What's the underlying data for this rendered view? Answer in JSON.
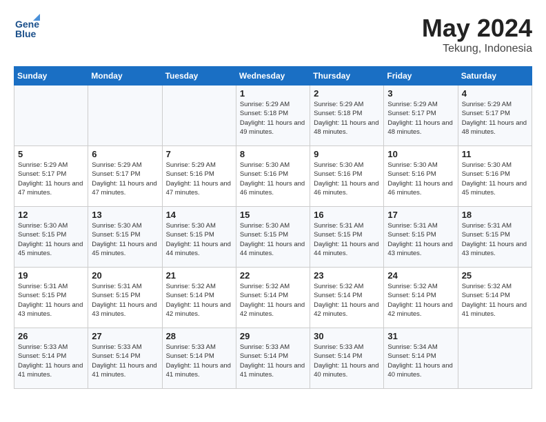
{
  "header": {
    "logo_line1": "General",
    "logo_line2": "Blue",
    "month_year": "May 2024",
    "location": "Tekung, Indonesia"
  },
  "days_of_week": [
    "Sunday",
    "Monday",
    "Tuesday",
    "Wednesday",
    "Thursday",
    "Friday",
    "Saturday"
  ],
  "weeks": [
    [
      {
        "day": "",
        "info": ""
      },
      {
        "day": "",
        "info": ""
      },
      {
        "day": "",
        "info": ""
      },
      {
        "day": "1",
        "info": "Sunrise: 5:29 AM\nSunset: 5:18 PM\nDaylight: 11 hours\nand 49 minutes."
      },
      {
        "day": "2",
        "info": "Sunrise: 5:29 AM\nSunset: 5:18 PM\nDaylight: 11 hours\nand 48 minutes."
      },
      {
        "day": "3",
        "info": "Sunrise: 5:29 AM\nSunset: 5:17 PM\nDaylight: 11 hours\nand 48 minutes."
      },
      {
        "day": "4",
        "info": "Sunrise: 5:29 AM\nSunset: 5:17 PM\nDaylight: 11 hours\nand 48 minutes."
      }
    ],
    [
      {
        "day": "5",
        "info": "Sunrise: 5:29 AM\nSunset: 5:17 PM\nDaylight: 11 hours\nand 47 minutes."
      },
      {
        "day": "6",
        "info": "Sunrise: 5:29 AM\nSunset: 5:17 PM\nDaylight: 11 hours\nand 47 minutes."
      },
      {
        "day": "7",
        "info": "Sunrise: 5:29 AM\nSunset: 5:16 PM\nDaylight: 11 hours\nand 47 minutes."
      },
      {
        "day": "8",
        "info": "Sunrise: 5:30 AM\nSunset: 5:16 PM\nDaylight: 11 hours\nand 46 minutes."
      },
      {
        "day": "9",
        "info": "Sunrise: 5:30 AM\nSunset: 5:16 PM\nDaylight: 11 hours\nand 46 minutes."
      },
      {
        "day": "10",
        "info": "Sunrise: 5:30 AM\nSunset: 5:16 PM\nDaylight: 11 hours\nand 46 minutes."
      },
      {
        "day": "11",
        "info": "Sunrise: 5:30 AM\nSunset: 5:16 PM\nDaylight: 11 hours\nand 45 minutes."
      }
    ],
    [
      {
        "day": "12",
        "info": "Sunrise: 5:30 AM\nSunset: 5:15 PM\nDaylight: 11 hours\nand 45 minutes."
      },
      {
        "day": "13",
        "info": "Sunrise: 5:30 AM\nSunset: 5:15 PM\nDaylight: 11 hours\nand 45 minutes."
      },
      {
        "day": "14",
        "info": "Sunrise: 5:30 AM\nSunset: 5:15 PM\nDaylight: 11 hours\nand 44 minutes."
      },
      {
        "day": "15",
        "info": "Sunrise: 5:30 AM\nSunset: 5:15 PM\nDaylight: 11 hours\nand 44 minutes."
      },
      {
        "day": "16",
        "info": "Sunrise: 5:31 AM\nSunset: 5:15 PM\nDaylight: 11 hours\nand 44 minutes."
      },
      {
        "day": "17",
        "info": "Sunrise: 5:31 AM\nSunset: 5:15 PM\nDaylight: 11 hours\nand 43 minutes."
      },
      {
        "day": "18",
        "info": "Sunrise: 5:31 AM\nSunset: 5:15 PM\nDaylight: 11 hours\nand 43 minutes."
      }
    ],
    [
      {
        "day": "19",
        "info": "Sunrise: 5:31 AM\nSunset: 5:15 PM\nDaylight: 11 hours\nand 43 minutes."
      },
      {
        "day": "20",
        "info": "Sunrise: 5:31 AM\nSunset: 5:15 PM\nDaylight: 11 hours\nand 43 minutes."
      },
      {
        "day": "21",
        "info": "Sunrise: 5:32 AM\nSunset: 5:14 PM\nDaylight: 11 hours\nand 42 minutes."
      },
      {
        "day": "22",
        "info": "Sunrise: 5:32 AM\nSunset: 5:14 PM\nDaylight: 11 hours\nand 42 minutes."
      },
      {
        "day": "23",
        "info": "Sunrise: 5:32 AM\nSunset: 5:14 PM\nDaylight: 11 hours\nand 42 minutes."
      },
      {
        "day": "24",
        "info": "Sunrise: 5:32 AM\nSunset: 5:14 PM\nDaylight: 11 hours\nand 42 minutes."
      },
      {
        "day": "25",
        "info": "Sunrise: 5:32 AM\nSunset: 5:14 PM\nDaylight: 11 hours\nand 41 minutes."
      }
    ],
    [
      {
        "day": "26",
        "info": "Sunrise: 5:33 AM\nSunset: 5:14 PM\nDaylight: 11 hours\nand 41 minutes."
      },
      {
        "day": "27",
        "info": "Sunrise: 5:33 AM\nSunset: 5:14 PM\nDaylight: 11 hours\nand 41 minutes."
      },
      {
        "day": "28",
        "info": "Sunrise: 5:33 AM\nSunset: 5:14 PM\nDaylight: 11 hours\nand 41 minutes."
      },
      {
        "day": "29",
        "info": "Sunrise: 5:33 AM\nSunset: 5:14 PM\nDaylight: 11 hours\nand 41 minutes."
      },
      {
        "day": "30",
        "info": "Sunrise: 5:33 AM\nSunset: 5:14 PM\nDaylight: 11 hours\nand 40 minutes."
      },
      {
        "day": "31",
        "info": "Sunrise: 5:34 AM\nSunset: 5:14 PM\nDaylight: 11 hours\nand 40 minutes."
      },
      {
        "day": "",
        "info": ""
      }
    ]
  ]
}
